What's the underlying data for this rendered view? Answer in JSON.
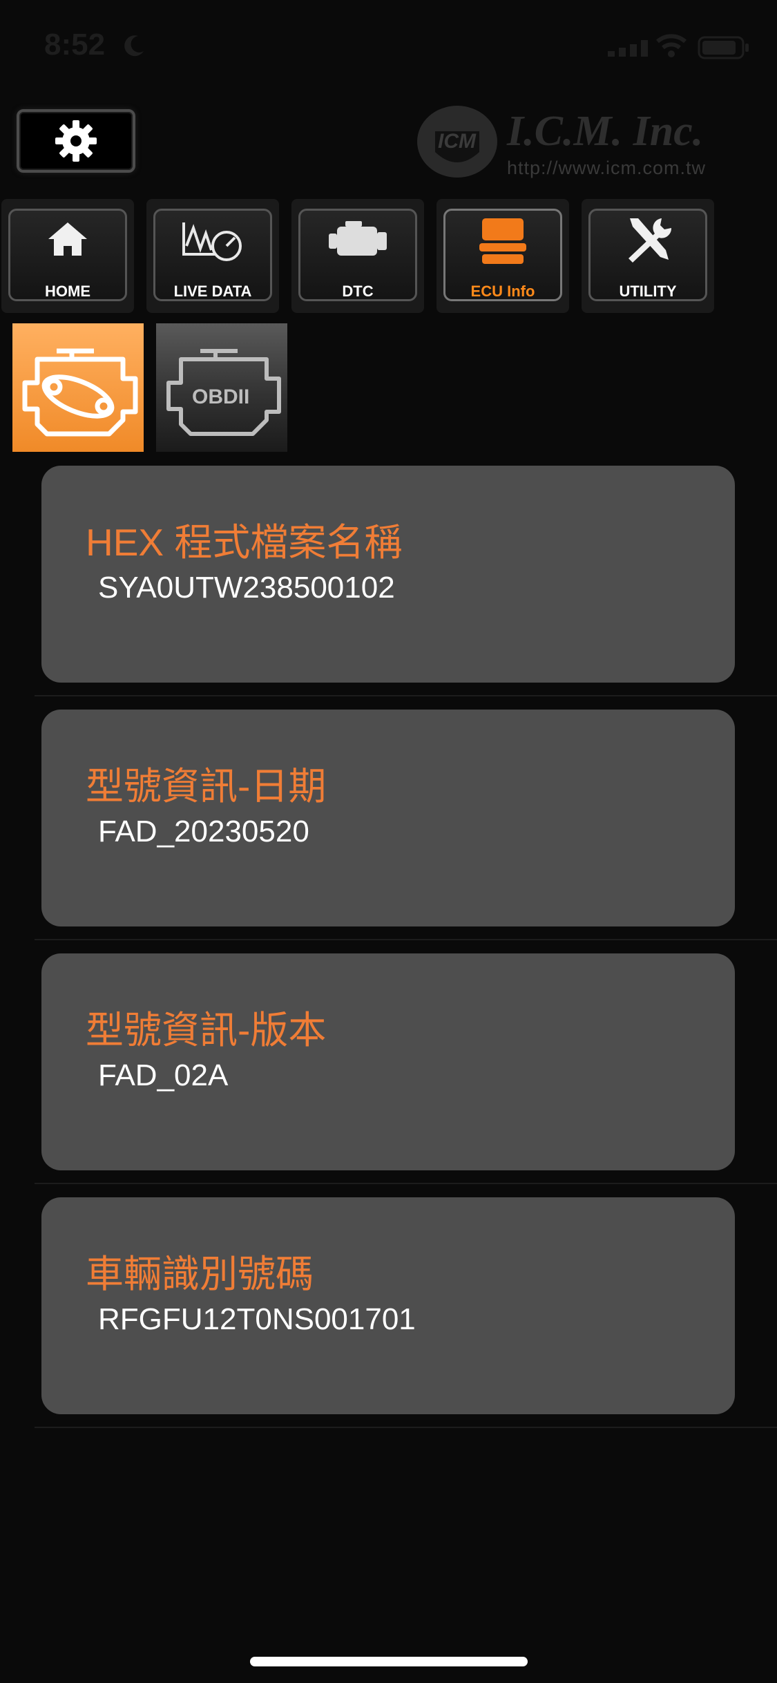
{
  "status_bar": {
    "time": "8:52"
  },
  "header": {
    "brand_name": "I.C.M. Inc.",
    "brand_url": "http://www.icm.com.tw",
    "logo_text": "ICM"
  },
  "nav": {
    "tabs": [
      {
        "label": "HOME",
        "icon": "home-icon"
      },
      {
        "label": "LIVE DATA",
        "icon": "live-data-icon"
      },
      {
        "label": "DTC",
        "icon": "engine-icon"
      },
      {
        "label": "ECU Info",
        "icon": "ecu-icon",
        "active": true
      },
      {
        "label": "UTILITY",
        "icon": "tools-icon"
      }
    ]
  },
  "sub_tabs": {
    "obd_label": "OBDII"
  },
  "cards": [
    {
      "title": "HEX 程式檔案名稱",
      "value": "SYA0UTW238500102"
    },
    {
      "title": "型號資訊-日期",
      "value": "FAD_20230520"
    },
    {
      "title": "型號資訊-版本",
      "value": "FAD_02A"
    },
    {
      "title": "車輛識別號碼",
      "value": "RFGFU12T0NS001701"
    }
  ],
  "colors": {
    "accent": "#f07d36",
    "card_bg": "#4e4e4e",
    "background": "#0a0a0a"
  }
}
